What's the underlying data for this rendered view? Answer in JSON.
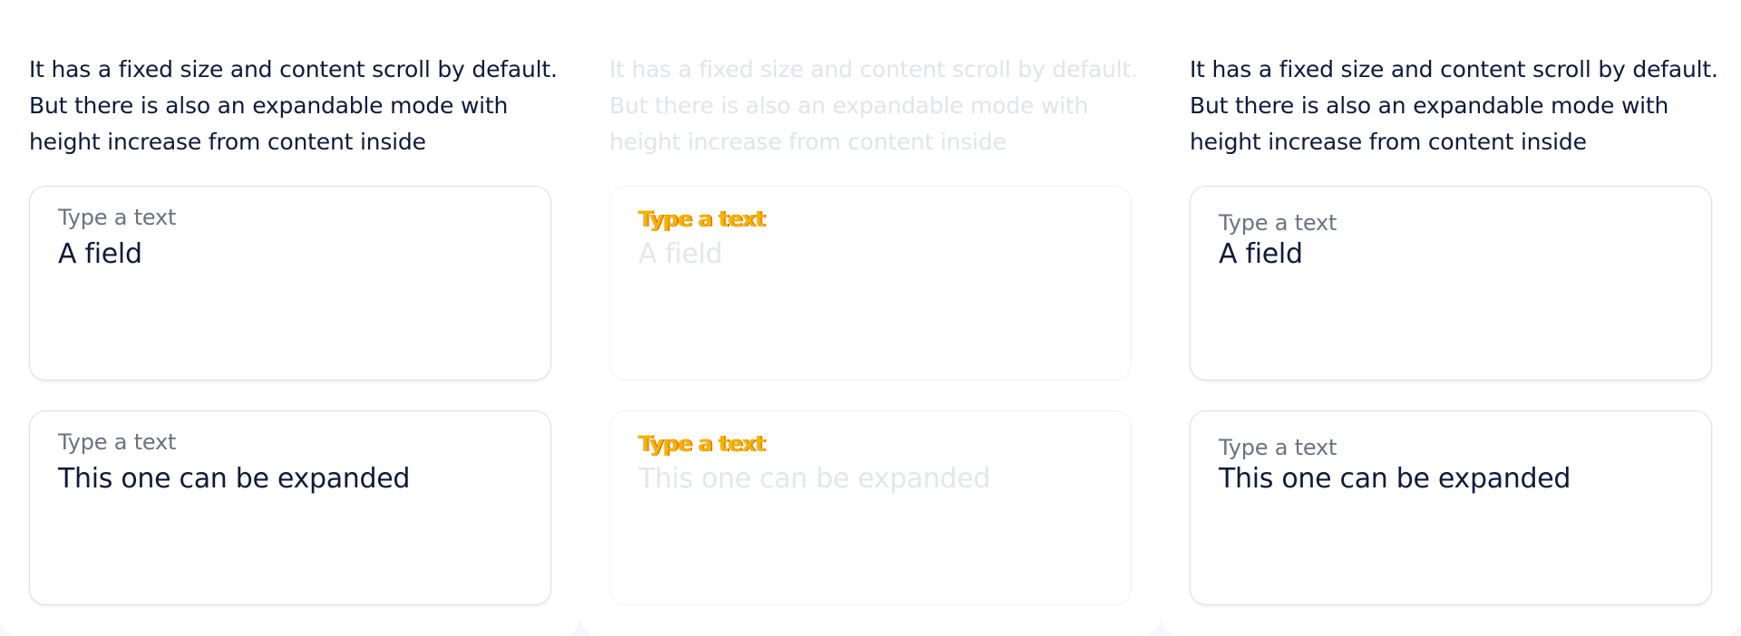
{
  "panels": [
    {
      "description": "It has a fixed size and content scroll by default. But there is also an expandable mode with height increase from content inside",
      "fields": [
        {
          "label": "Type a text",
          "value": "A field"
        },
        {
          "label": "Type a text",
          "value": "This one can be expanded"
        }
      ]
    },
    {
      "description": "It has a fixed size and content scroll by default. But there is also an expandable mode with height increase from content inside",
      "fields": [
        {
          "label": "Type a text",
          "value": "A field"
        },
        {
          "label": "Type a text",
          "value": "This one can be expanded"
        }
      ]
    },
    {
      "description": "It has a fixed size and content scroll by default. But there is also an expandable mode with height increase from content inside",
      "fields": [
        {
          "label": "Type a text",
          "value": "A field"
        },
        {
          "label": "Type a text",
          "value": "This one can be expanded"
        }
      ]
    }
  ],
  "colors": {
    "text_primary": "#0f1a3a",
    "label_gray": "#6b7280",
    "border": "#dcdfe5",
    "disabled_text": "#e1e4e9",
    "highlight_label": "#f2b400"
  }
}
